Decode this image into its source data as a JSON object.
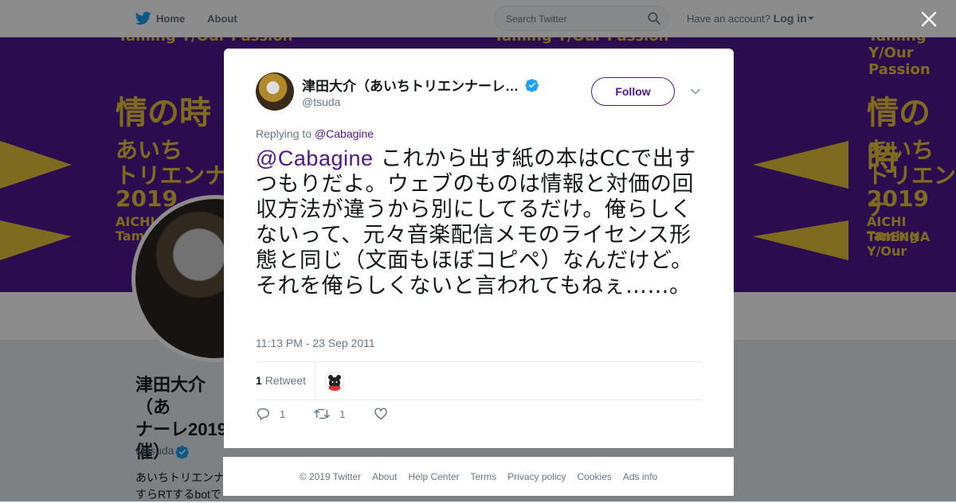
{
  "nav": {
    "home_label": "Home",
    "about_label": "About",
    "search_placeholder": "Search Twitter",
    "account_prompt": "Have an account?",
    "login_label": "Log in"
  },
  "banner": {
    "lines": [
      "Taming Y/Our Passion",
      "情の時",
      "あいち",
      "トリエンナ",
      "2019",
      "AICHI TRIENNA",
      "Taming Y/Our"
    ],
    "bg_color": "#4e1691",
    "text_color": "#e7c43a"
  },
  "profile": {
    "name": "津田大介（あいちトリエンナーレ2019芸術監督 催）",
    "name_lines": [
      "津田大介（あ",
      "ナーレ2019",
      "催）"
    ],
    "handle": "@tsuda",
    "bio_lines": [
      "あいちトリエンナ",
      "すらRTするbotで"
    ]
  },
  "tweet": {
    "author_name": "津田大介（あいちトリエンナーレ…",
    "author_handle": "@tsuda",
    "follow_label": "Follow",
    "replying_prefix": "Replying to",
    "replying_to": "@Cabagine",
    "mention": "@Cabagine",
    "body": " これから出す紙の本はCCで出すつもりだよ。ウェブのものは情報と対価の回収方法が違うから別にしてるだけ。俺らしくないって、元々音楽配信メモのライセンス形態と同じ（文面もほぼコピペ）なんだけど。それを俺らしくないと言われてもねぇ……。",
    "timestamp": "11:13 PM - 23 Sep 2011",
    "retweet_count": "1",
    "retweet_label": "Retweet",
    "reply_count": "1",
    "rt_action_count": "1",
    "like_count": ""
  },
  "footer": {
    "links": [
      "© 2019 Twitter",
      "About",
      "Help Center",
      "Terms",
      "Privacy policy",
      "Cookies",
      "Ads info"
    ]
  },
  "colors": {
    "accent": "#4e1691",
    "twitter_blue": "#1da1f2",
    "verified": "#1da1f2"
  }
}
